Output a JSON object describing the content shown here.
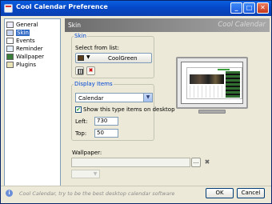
{
  "window": {
    "title": "Cool Calendar Preference",
    "controls": {
      "minimize": "_",
      "maximize": "□",
      "close": "✕"
    }
  },
  "tree": {
    "items": [
      {
        "label": "General",
        "icon": "general-icon",
        "selected": false
      },
      {
        "label": "Skin",
        "icon": "skin-icon",
        "selected": true
      },
      {
        "label": "Events",
        "icon": "events-icon",
        "selected": false
      },
      {
        "label": "Reminder",
        "icon": "reminder-icon",
        "selected": false
      },
      {
        "label": "Wallpaper",
        "icon": "wallpaper-icon",
        "selected": false
      },
      {
        "label": "Plugins",
        "icon": "plugins-icon",
        "selected": false
      }
    ]
  },
  "header": {
    "title": "Skin",
    "brand": "Cool Calendar"
  },
  "skin": {
    "legend": "Skin",
    "select_label": "Select from list:",
    "selected_skin": "CoolGreen",
    "dropdown_arrow": "▼",
    "delete_glyph": "✖"
  },
  "display": {
    "legend": "Display Items",
    "selected_item": "Calendar",
    "select_arrow": "▼",
    "show_label": "Show this type items on desktop",
    "show_checked": true,
    "check_glyph": "✔",
    "left_label": "Left:",
    "left_value": "730",
    "top_label": "Top:",
    "top_value": "50"
  },
  "wallpaper": {
    "label": "Wallpaper:",
    "path": "",
    "browse_label": "...",
    "delete_glyph": "✖",
    "mode_arrow": "▼"
  },
  "footer": {
    "info_glyph": "i",
    "text": "Cool Calendar, try to be the best desktop calendar software",
    "ok_label": "OK",
    "cancel_label": "Cancel"
  },
  "colors": {
    "titlebar": "#0548c7",
    "selection": "#316ac5",
    "legend_text": "#0046d5",
    "header_band": "#8a8a8a"
  }
}
